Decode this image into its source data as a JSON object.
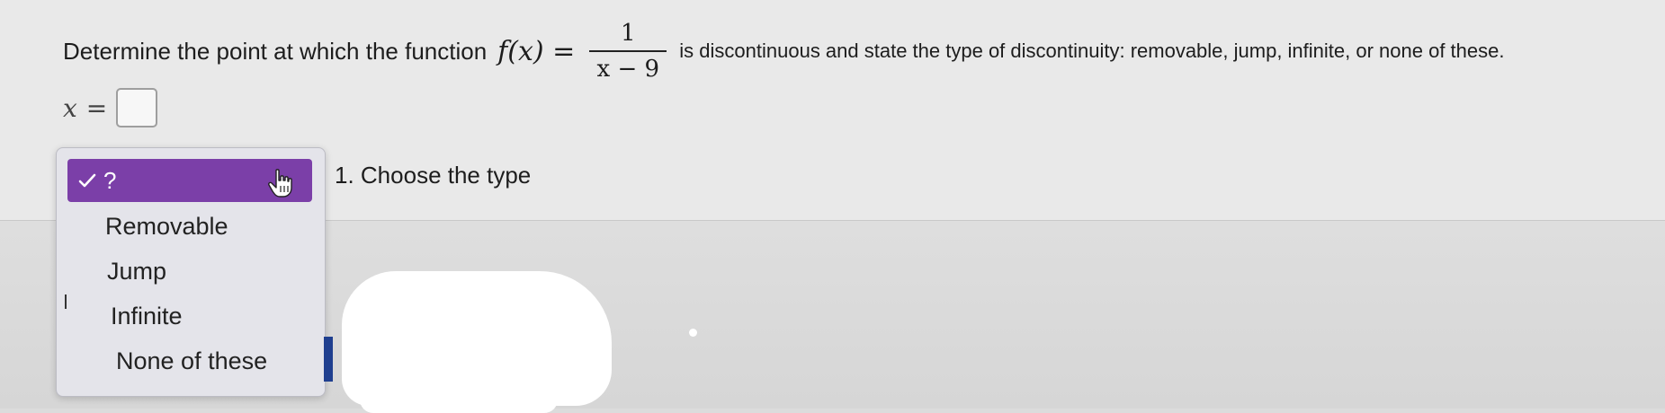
{
  "question": {
    "lead": "Determine the point at which the function",
    "function_name": "f(x) =",
    "numerator": "1",
    "denominator": "x − 9",
    "trail": "is discontinuous and state the type of discontinuity: removable, jump, infinite, or none of these."
  },
  "answer": {
    "variable": "x",
    "equals": "=",
    "value": ""
  },
  "step_prompt": "1. Choose the type",
  "dropdown": {
    "selected": "?",
    "options": [
      "Removable",
      "Jump",
      "Infinite",
      "None of these"
    ]
  },
  "colors": {
    "accent": "#7b3fa8",
    "background": "#e9e9e9"
  },
  "icons": {
    "check": "checkmark-icon",
    "cursor": "hand-cursor-icon"
  }
}
